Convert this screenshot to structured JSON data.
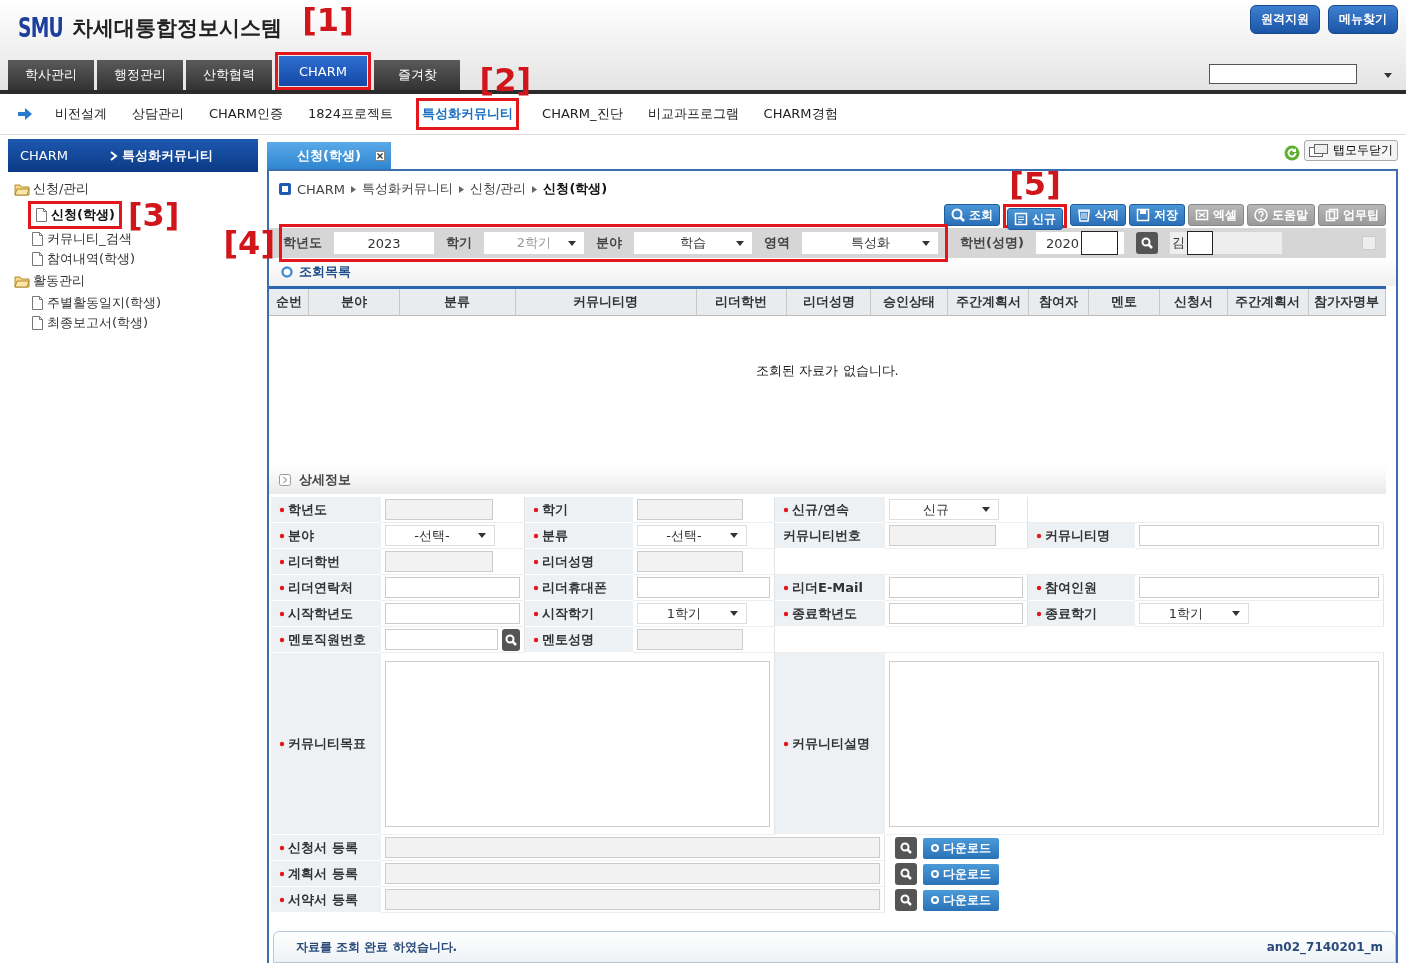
{
  "header": {
    "logo": "SMU",
    "title": "차세대통합정보시스템",
    "buttons": [
      "원격지원",
      "메뉴찾기"
    ],
    "tabs": [
      {
        "label": "학사관리",
        "selected": false
      },
      {
        "label": "행정관리",
        "selected": false
      },
      {
        "label": "산학협력",
        "selected": false
      },
      {
        "label": "CHARM",
        "selected": true,
        "callout": {
          "text": "[1]"
        }
      },
      {
        "label": "즐겨찾",
        "selected": false
      }
    ]
  },
  "submenu": [
    {
      "label": "비전설계",
      "selected": false
    },
    {
      "label": "상담관리",
      "selected": false
    },
    {
      "label": "CHARM인증",
      "selected": false
    },
    {
      "label": "1824프로젝트",
      "selected": false
    },
    {
      "label": "특성화커뮤니티",
      "selected": true,
      "callout": {
        "text": "[2]"
      }
    },
    {
      "label": "CHARM_진단",
      "selected": false
    },
    {
      "label": "비교과프로그램",
      "selected": false
    },
    {
      "label": "CHARM경험",
      "selected": false
    }
  ],
  "sidebar": {
    "root": "CHARM",
    "current": "특성화커뮤니티",
    "tree": [
      {
        "label": "신청/관리",
        "children": [
          {
            "label": "신청(학생)",
            "selected": true,
            "callout": {
              "text": "[3]"
            }
          },
          {
            "label": "커뮤니티_검색",
            "selected": false
          },
          {
            "label": "참여내역(학생)",
            "selected": false
          }
        ]
      },
      {
        "label": "활동관리",
        "children": [
          {
            "label": "주별활동일지(학생)",
            "selected": false
          },
          {
            "label": "최종보고서(학생)",
            "selected": false
          }
        ]
      }
    ]
  },
  "workspace": {
    "tabs": [
      {
        "label": "신청(학생)",
        "selected": true
      }
    ],
    "close_all": "탭모두닫기",
    "breadcrumb": [
      "CHARM",
      "특성화커뮤니티",
      "신청/관리",
      "신청(학생)"
    ],
    "toolbar": [
      {
        "label": "조회",
        "disabled": false
      },
      {
        "label": "신규",
        "disabled": false,
        "callout": {
          "text": "[5]"
        }
      },
      {
        "label": "삭제",
        "disabled": false
      },
      {
        "label": "저장",
        "disabled": false
      },
      {
        "label": "엑셀",
        "disabled": true
      },
      {
        "label": "도움말",
        "disabled": true
      },
      {
        "label": "업무팁",
        "disabled": true
      }
    ],
    "search": {
      "callout": {
        "text": "[4]"
      },
      "fields": [
        {
          "label": "학년도",
          "kind": "text",
          "value": "2023"
        },
        {
          "label": "학기",
          "kind": "select",
          "value": "2학기",
          "disabled": true
        },
        {
          "label": "분야",
          "kind": "select",
          "value": "학습",
          "disabled": false
        },
        {
          "label": "영역",
          "kind": "select",
          "value": "특성화",
          "disabled": false
        }
      ],
      "student": {
        "label": "학번(성명)",
        "id": "2020",
        "name": "김"
      },
      "select_all": {
        "checked": false
      }
    },
    "list_title": "조회목록",
    "table": {
      "columns": [
        "순번",
        "분야",
        "분류",
        "커뮤니티명",
        "리더학번",
        "리더성명",
        "승인상태",
        "주간계획서",
        "참여자",
        "멘토",
        "신청서",
        "주간계획서",
        "참가자명부"
      ],
      "empty_message": "조회된 자료가 없습니다."
    },
    "detail": {
      "title": "상세정보",
      "rows": [
        [
          {
            "label": "학년도",
            "required": true,
            "kind": "text",
            "readonly": true
          },
          {
            "label": "학기",
            "required": true,
            "kind": "text",
            "readonly": true
          },
          {
            "label": "신규/연속",
            "required": true,
            "kind": "select",
            "value": "신규"
          }
        ],
        [
          {
            "label": "분야",
            "required": true,
            "kind": "select",
            "value": "-선택-"
          },
          {
            "label": "분류",
            "required": true,
            "kind": "select",
            "value": "-선택-"
          },
          {
            "label": "커뮤니티번호",
            "required": false,
            "kind": "text",
            "readonly": true
          },
          {
            "label": "커뮤니티명",
            "required": true,
            "kind": "text",
            "readonly": false
          }
        ],
        [
          {
            "label": "리더학번",
            "required": true,
            "kind": "text",
            "readonly": true
          },
          {
            "label": "리더성명",
            "required": true,
            "kind": "text",
            "readonly": true
          }
        ],
        [
          {
            "label": "리더연락처",
            "required": true,
            "kind": "text",
            "readonly": false
          },
          {
            "label": "리더휴대폰",
            "required": true,
            "kind": "text",
            "readonly": false
          },
          {
            "label": "리더E-Mail",
            "required": true,
            "kind": "text",
            "readonly": false
          },
          {
            "label": "참여인원",
            "required": true,
            "kind": "text",
            "readonly": false
          }
        ],
        [
          {
            "label": "시작학년도",
            "required": true,
            "kind": "text",
            "readonly": false
          },
          {
            "label": "시작학기",
            "required": true,
            "kind": "select",
            "value": "1학기"
          },
          {
            "label": "종료학년도",
            "required": true,
            "kind": "text",
            "readonly": false
          },
          {
            "label": "종료학기",
            "required": true,
            "kind": "select",
            "value": "1학기"
          }
        ],
        [
          {
            "label": "멘토직원번호",
            "required": true,
            "kind": "search"
          },
          {
            "label": "멘토성명",
            "required": true,
            "kind": "text",
            "readonly": true
          }
        ],
        [
          {
            "label": "커뮤니티목표",
            "required": true,
            "kind": "textarea"
          },
          "",
          {
            "label": "커뮤니티설명",
            "required": true,
            "kind": "textarea"
          }
        ],
        [
          {
            "label": "신청서 등록",
            "required": true,
            "kind": "file",
            "action": "다운로드"
          }
        ],
        [
          {
            "label": "계획서 등록",
            "required": true,
            "kind": "file",
            "action": "다운로드"
          }
        ],
        [
          {
            "label": "서약서 등록",
            "required": true,
            "kind": "file",
            "action": "다운로드"
          }
        ]
      ]
    },
    "status": {
      "message": "자료를 조회 완료 하였습니다.",
      "screen_id": "an02_7140201_m"
    }
  }
}
